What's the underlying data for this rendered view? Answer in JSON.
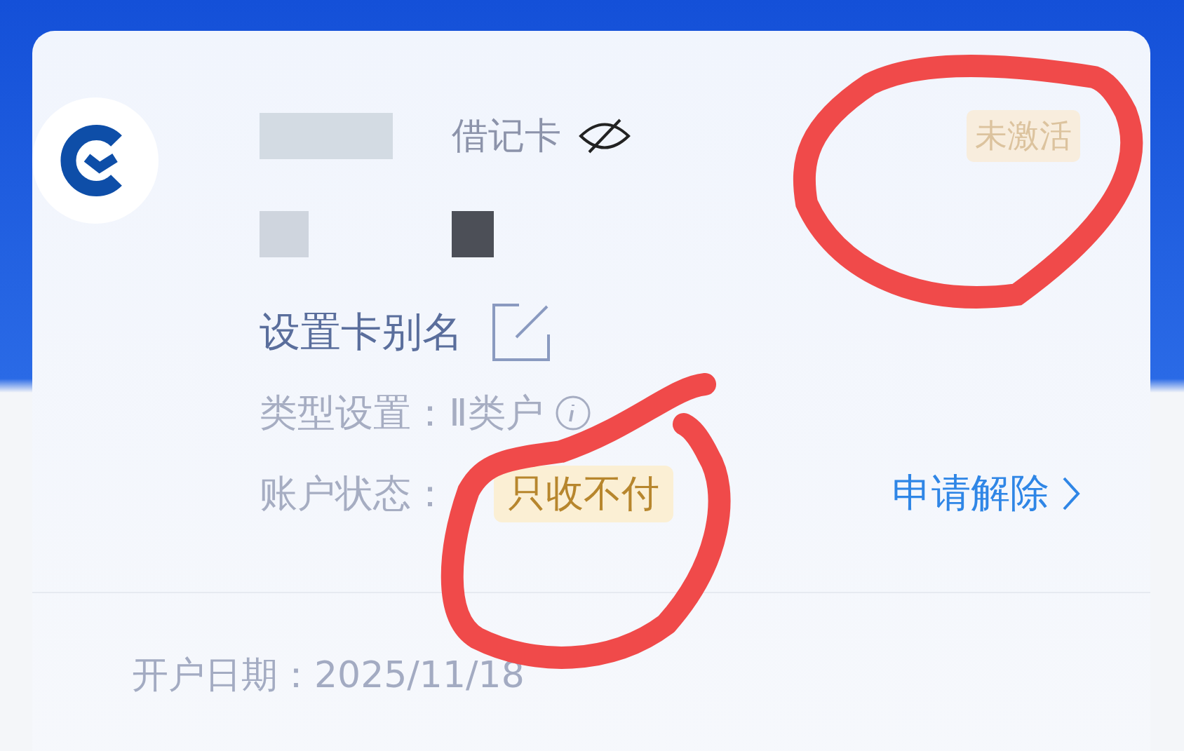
{
  "card": {
    "type_label": "借记卡",
    "status_badge": "未激活",
    "alias_link": "设置卡别名",
    "account_type_label": "类型设置：",
    "account_type_value": "Ⅱ类户",
    "account_status_label": "账户状态：",
    "account_status_value": "只收不付",
    "release_link": "申请解除",
    "open_date_label": "开户日期：",
    "open_date_value": "2025/11/18"
  }
}
